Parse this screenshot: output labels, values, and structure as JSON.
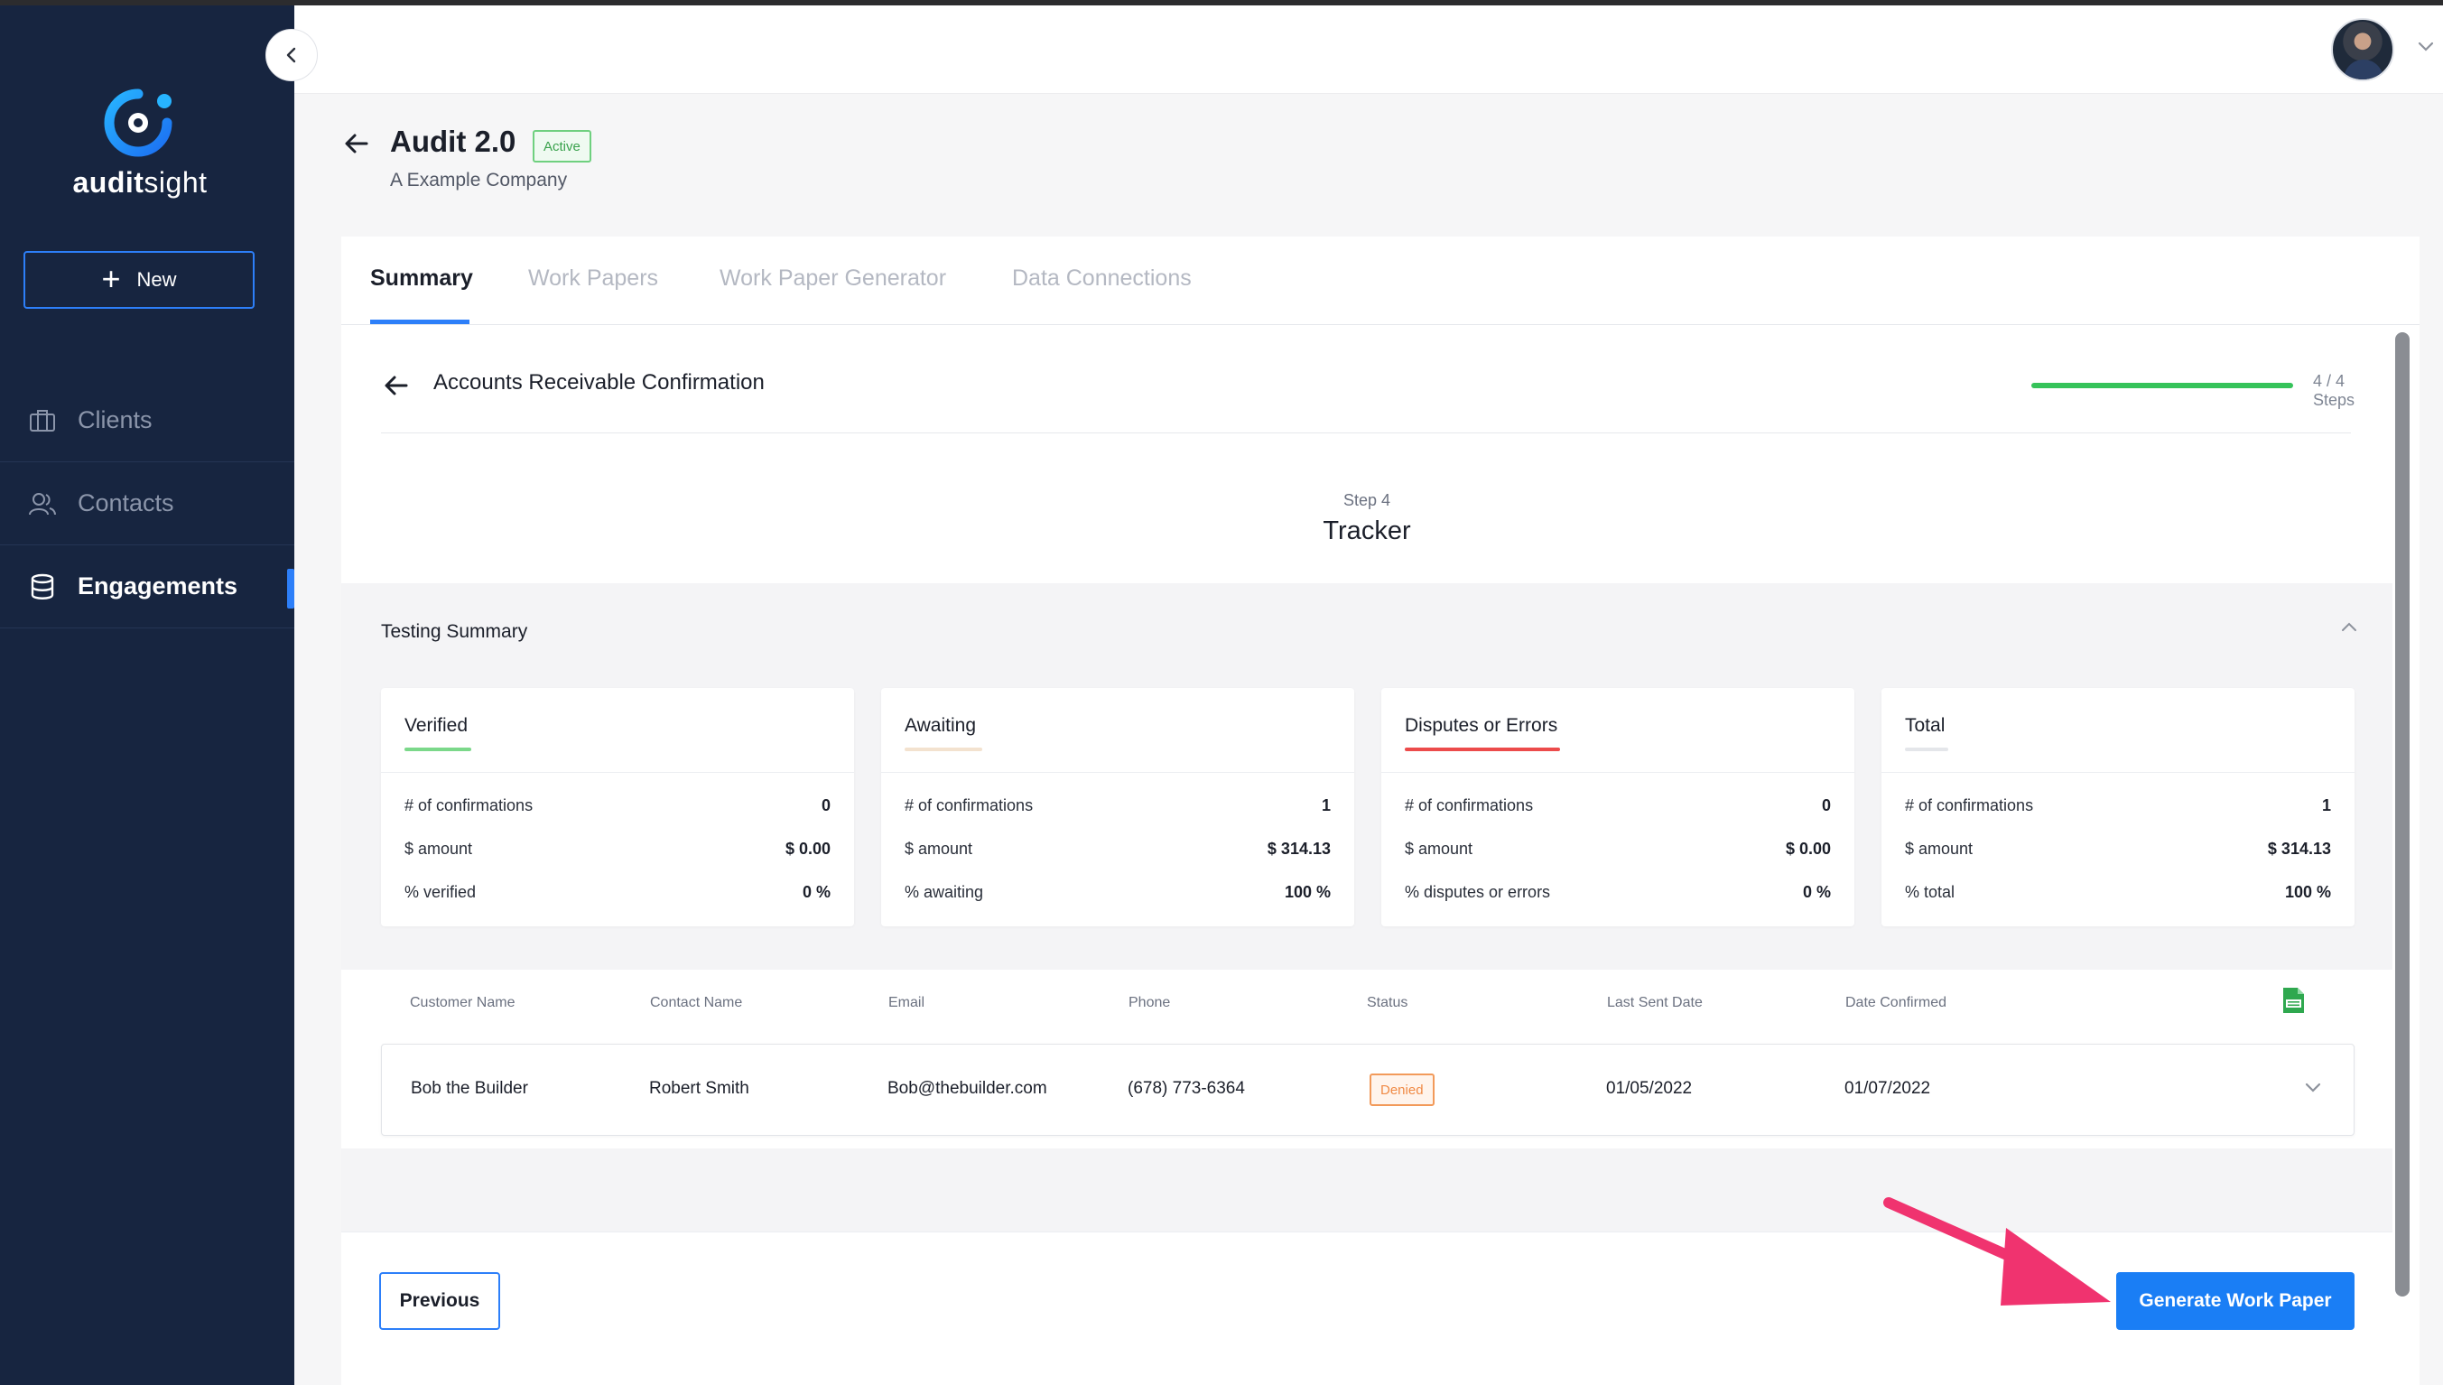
{
  "brand": {
    "name_bold": "audit",
    "name_light": "sight"
  },
  "sidebar": {
    "new_label": "New",
    "items": [
      {
        "label": "Clients",
        "icon": "briefcase-icon"
      },
      {
        "label": "Contacts",
        "icon": "users-icon"
      },
      {
        "label": "Engagements",
        "icon": "database-icon",
        "active": true
      }
    ]
  },
  "page": {
    "title": "Audit 2.0",
    "status_badge": "Active",
    "subtitle": "A Example Company"
  },
  "tabs": [
    "Summary",
    "Work Papers",
    "Work Paper Generator",
    "Data Connections"
  ],
  "active_tab": "Summary",
  "step": {
    "title": "Accounts Receivable Confirmation",
    "progress": 1.0,
    "steps_text": "4 / 4 Steps",
    "label": "Step 4",
    "name": "Tracker"
  },
  "summary": {
    "title": "Testing Summary",
    "cards": [
      {
        "name": "Verified",
        "color": "#7bd88a",
        "rows": [
          {
            "label": "# of confirmations",
            "value": "0"
          },
          {
            "label": "$ amount",
            "value": "$ 0.00"
          },
          {
            "label": "% verified",
            "value": "0 %"
          }
        ]
      },
      {
        "name": "Awaiting",
        "color": "#f3e2cf",
        "rows": [
          {
            "label": "# of confirmations",
            "value": "1"
          },
          {
            "label": "$ amount",
            "value": "$ 314.13"
          },
          {
            "label": "% awaiting",
            "value": "100 %"
          }
        ]
      },
      {
        "name": "Disputes or Errors",
        "color": "#ec4b4b",
        "rows": [
          {
            "label": "# of confirmations",
            "value": "0"
          },
          {
            "label": "$ amount",
            "value": "$ 0.00"
          },
          {
            "label": "% disputes or errors",
            "value": "0 %"
          }
        ]
      },
      {
        "name": "Total",
        "color": "#e4e6ea",
        "rows": [
          {
            "label": "# of confirmations",
            "value": "1"
          },
          {
            "label": "$ amount",
            "value": "$ 314.13"
          },
          {
            "label": "% total",
            "value": "100 %"
          }
        ]
      }
    ]
  },
  "table": {
    "columns": [
      "Customer Name",
      "Contact Name",
      "Email",
      "Phone",
      "Status",
      "Last Sent Date",
      "Date Confirmed"
    ],
    "rows": [
      {
        "customer": "Bob the Builder",
        "contact": "Robert Smith",
        "email": "Bob@thebuilder.com",
        "phone": "(678) 773-6364",
        "status": "Denied",
        "last_sent": "01/05/2022",
        "confirmed": "01/07/2022"
      }
    ]
  },
  "footer": {
    "previous_label": "Previous",
    "generate_label": "Generate Work Paper"
  },
  "colors": {
    "sidebar": "#172540",
    "accent": "#1a7ef5",
    "annotation_arrow": "#f0336f"
  }
}
